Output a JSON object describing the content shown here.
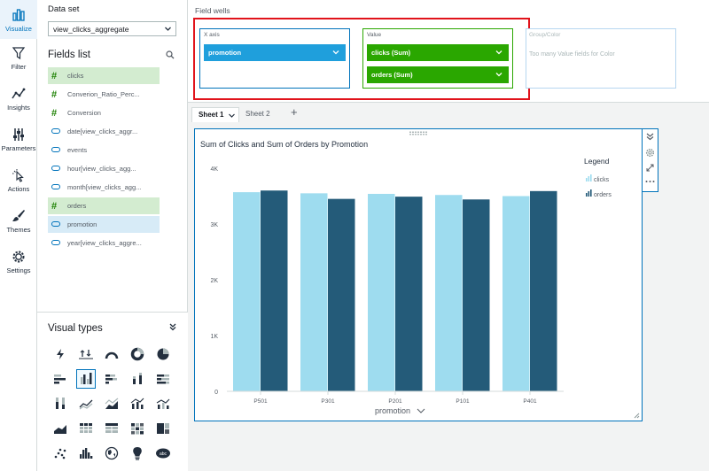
{
  "rail": {
    "visualize": "Visualize",
    "filter": "Filter",
    "insights": "Insights",
    "parameters": "Parameters",
    "actions": "Actions",
    "themes": "Themes",
    "settings": "Settings"
  },
  "dataset": {
    "label": "Data set",
    "selected": "view_clicks_aggregate"
  },
  "fields_list": {
    "title": "Fields list",
    "items": [
      {
        "label": "clicks",
        "kind": "measure",
        "selected": true
      },
      {
        "label": "Converion_Ratio_Perc...",
        "kind": "measure",
        "selected": false
      },
      {
        "label": "Conversion",
        "kind": "measure",
        "selected": false
      },
      {
        "label": "date[view_clicks_aggr...",
        "kind": "dimension",
        "selected": false
      },
      {
        "label": "events",
        "kind": "dimension",
        "selected": false
      },
      {
        "label": "hour[view_clicks_agg...",
        "kind": "dimension",
        "selected": false
      },
      {
        "label": "month[view_clicks_agg...",
        "kind": "dimension",
        "selected": false
      },
      {
        "label": "orders",
        "kind": "measure",
        "selected": true
      },
      {
        "label": "promotion",
        "kind": "dimension",
        "selected": true
      },
      {
        "label": "year[view_clicks_aggre...",
        "kind": "dimension",
        "selected": false
      }
    ]
  },
  "visual_types": {
    "title": "Visual types",
    "selected": "clustered-bar-chart"
  },
  "field_wells": {
    "title": "Field wells",
    "x_axis": {
      "label": "X axis",
      "value": "promotion"
    },
    "value": {
      "label": "Value",
      "items": [
        "clicks (Sum)",
        "orders (Sum)"
      ]
    },
    "group_color": {
      "label": "Group/Color",
      "message": "Too many Value fields for Color"
    }
  },
  "sheets": {
    "tabs": [
      "Sheet 1",
      "Sheet 2"
    ],
    "add": "+"
  },
  "visual": {
    "x_field_label": "promotion",
    "legend_title": "Legend"
  },
  "colors": {
    "clicks": "#9edcef",
    "orders": "#245b79",
    "accent": "#0073bb",
    "highlight": "#e1131b",
    "green": "#2aa700",
    "blue": "#1f9fdc"
  },
  "chart_data": {
    "type": "bar",
    "title": "Sum of Clicks and Sum of Orders by Promotion",
    "xlabel": "promotion",
    "ylabel": "",
    "categories": [
      "P501",
      "P301",
      "P201",
      "P101",
      "P401"
    ],
    "series": [
      {
        "name": "clicks",
        "values": [
          3570,
          3550,
          3540,
          3520,
          3500
        ]
      },
      {
        "name": "orders",
        "values": [
          3600,
          3450,
          3490,
          3440,
          3590
        ]
      }
    ],
    "ylim": [
      0,
      4000
    ],
    "yticks": [
      0,
      1000,
      2000,
      3000,
      4000
    ],
    "ytick_labels": [
      "0",
      "1K",
      "2K",
      "3K",
      "4K"
    ],
    "grid": false,
    "legend": "right"
  }
}
